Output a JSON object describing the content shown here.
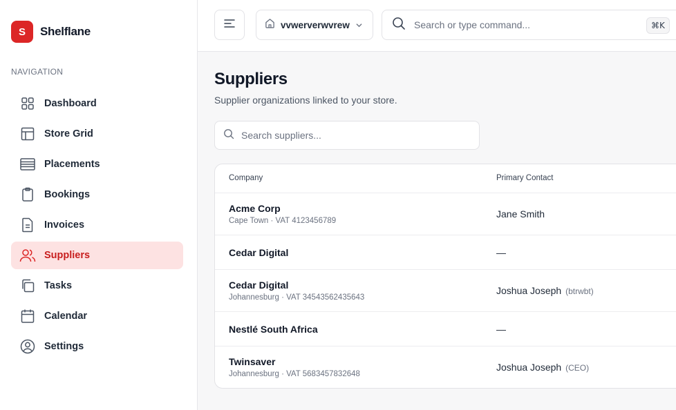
{
  "brand": {
    "logo_letter": "S",
    "name": "Shelflane",
    "accent": "#dc2626"
  },
  "sidebar": {
    "heading": "NAVIGATION",
    "items": [
      {
        "label": "Dashboard",
        "icon": "grid-icon",
        "active": false
      },
      {
        "label": "Store Grid",
        "icon": "layout-icon",
        "active": false
      },
      {
        "label": "Placements",
        "icon": "list-icon",
        "active": false
      },
      {
        "label": "Bookings",
        "icon": "clipboard-icon",
        "active": false
      },
      {
        "label": "Invoices",
        "icon": "file-icon",
        "active": false
      },
      {
        "label": "Suppliers",
        "icon": "users-icon",
        "active": true
      },
      {
        "label": "Tasks",
        "icon": "copy-icon",
        "active": false
      },
      {
        "label": "Calendar",
        "icon": "calendar-icon",
        "active": false
      },
      {
        "label": "Settings",
        "icon": "user-circle-icon",
        "active": false
      }
    ]
  },
  "topbar": {
    "store_name": "vvwerverwvrew",
    "command_placeholder": "Search or type command...",
    "shortcut": "⌘K"
  },
  "page": {
    "title": "Suppliers",
    "subtitle": "Supplier organizations linked to your store.",
    "search_placeholder": "Search suppliers..."
  },
  "table": {
    "columns": [
      "Company",
      "Primary Contact"
    ],
    "rows": [
      {
        "company": "Acme Corp",
        "meta": "Cape Town · VAT 4123456789",
        "contact": "Jane Smith",
        "role": ""
      },
      {
        "company": "Cedar Digital",
        "meta": "",
        "contact": "—",
        "role": ""
      },
      {
        "company": "Cedar Digital",
        "meta": "Johannesburg · VAT 34543562435643",
        "contact": "Joshua Joseph",
        "role": "(btrwbt)"
      },
      {
        "company": "Nestlé South Africa",
        "meta": "",
        "contact": "—",
        "role": ""
      },
      {
        "company": "Twinsaver",
        "meta": "Johannesburg · VAT 5683457832648",
        "contact": "Joshua Joseph",
        "role": "(CEO)"
      }
    ]
  }
}
